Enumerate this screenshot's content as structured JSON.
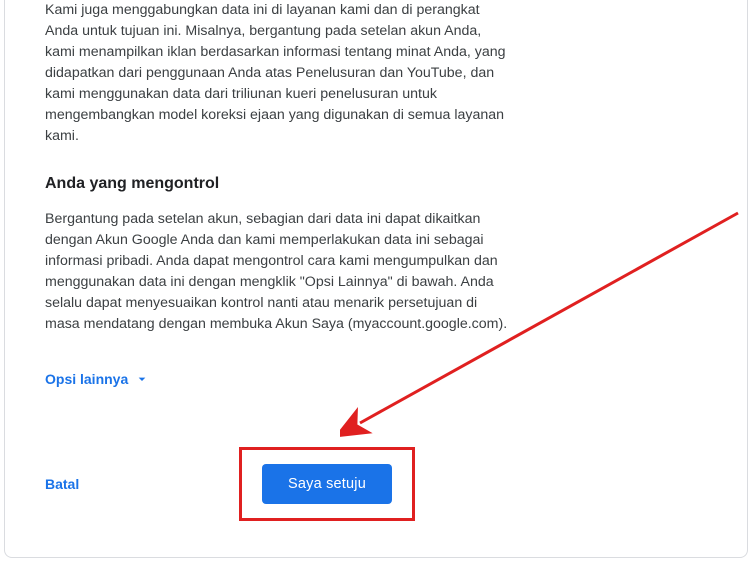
{
  "card": {
    "para1": "Kami juga menggabungkan data ini di layanan kami dan di perangkat Anda untuk tujuan ini. Misalnya, bergantung pada setelan akun Anda, kami menampilkan iklan berdasarkan informasi tentang minat Anda, yang didapatkan dari penggunaan Anda atas Penelusuran dan YouTube, dan kami menggunakan data dari triliunan kueri penelusuran untuk mengembangkan model koreksi ejaan yang digunakan di semua layanan kami.",
    "heading": "Anda yang mengontrol",
    "para2": "Bergantung pada setelan akun, sebagian dari data ini dapat dikaitkan dengan Akun Google Anda dan kami memperlakukan data ini sebagai informasi pribadi. Anda dapat mengontrol cara kami mengumpulkan dan menggunakan data ini dengan mengklik \"Opsi Lainnya\" di bawah. Anda selalu dapat menyesuaikan kontrol nanti atau menarik persetujuan di masa mendatang dengan membuka Akun Saya (myaccount.google.com).",
    "more_label": "Opsi lainnya",
    "cancel_label": "Batal",
    "agree_label": "Saya setuju"
  },
  "colors": {
    "accent": "#1a73e8",
    "highlight": "#e02020"
  }
}
